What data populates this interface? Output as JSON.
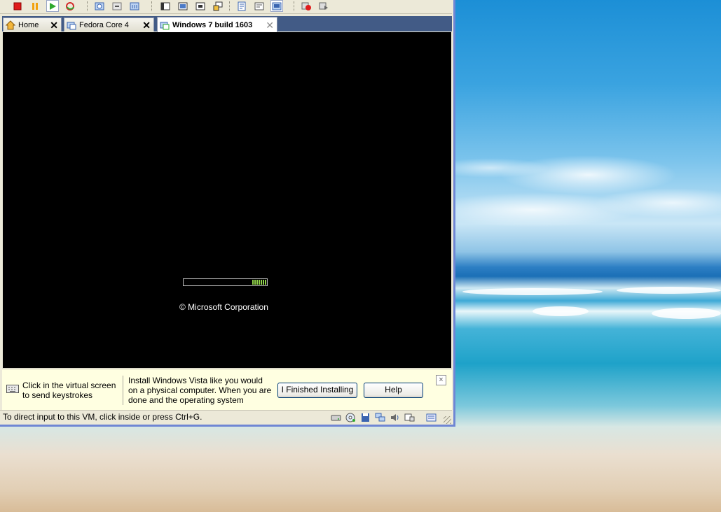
{
  "tabs": [
    {
      "label": "Home"
    },
    {
      "label": "Fedora Core 4"
    },
    {
      "label": "Windows 7 build 1603"
    }
  ],
  "vm_screen": {
    "copyright": "© Microsoft Corporation"
  },
  "hint_bar": {
    "keyboard_hint": "Click in the virtual screen to send keystrokes",
    "install_message": "Install Windows Vista like you would on a physical computer. When you are done and the operating system",
    "finished_button": "I Finished Installing",
    "help_button": "Help",
    "close_glyph": "×"
  },
  "status_bar": {
    "text": "To direct input to this VM, click inside or press Ctrl+G."
  },
  "colors": {
    "tab_strip": "#425b86",
    "window_border": "#6f86d4",
    "hint_background": "#ffffe1",
    "boot_progress": "#8fd04a"
  }
}
